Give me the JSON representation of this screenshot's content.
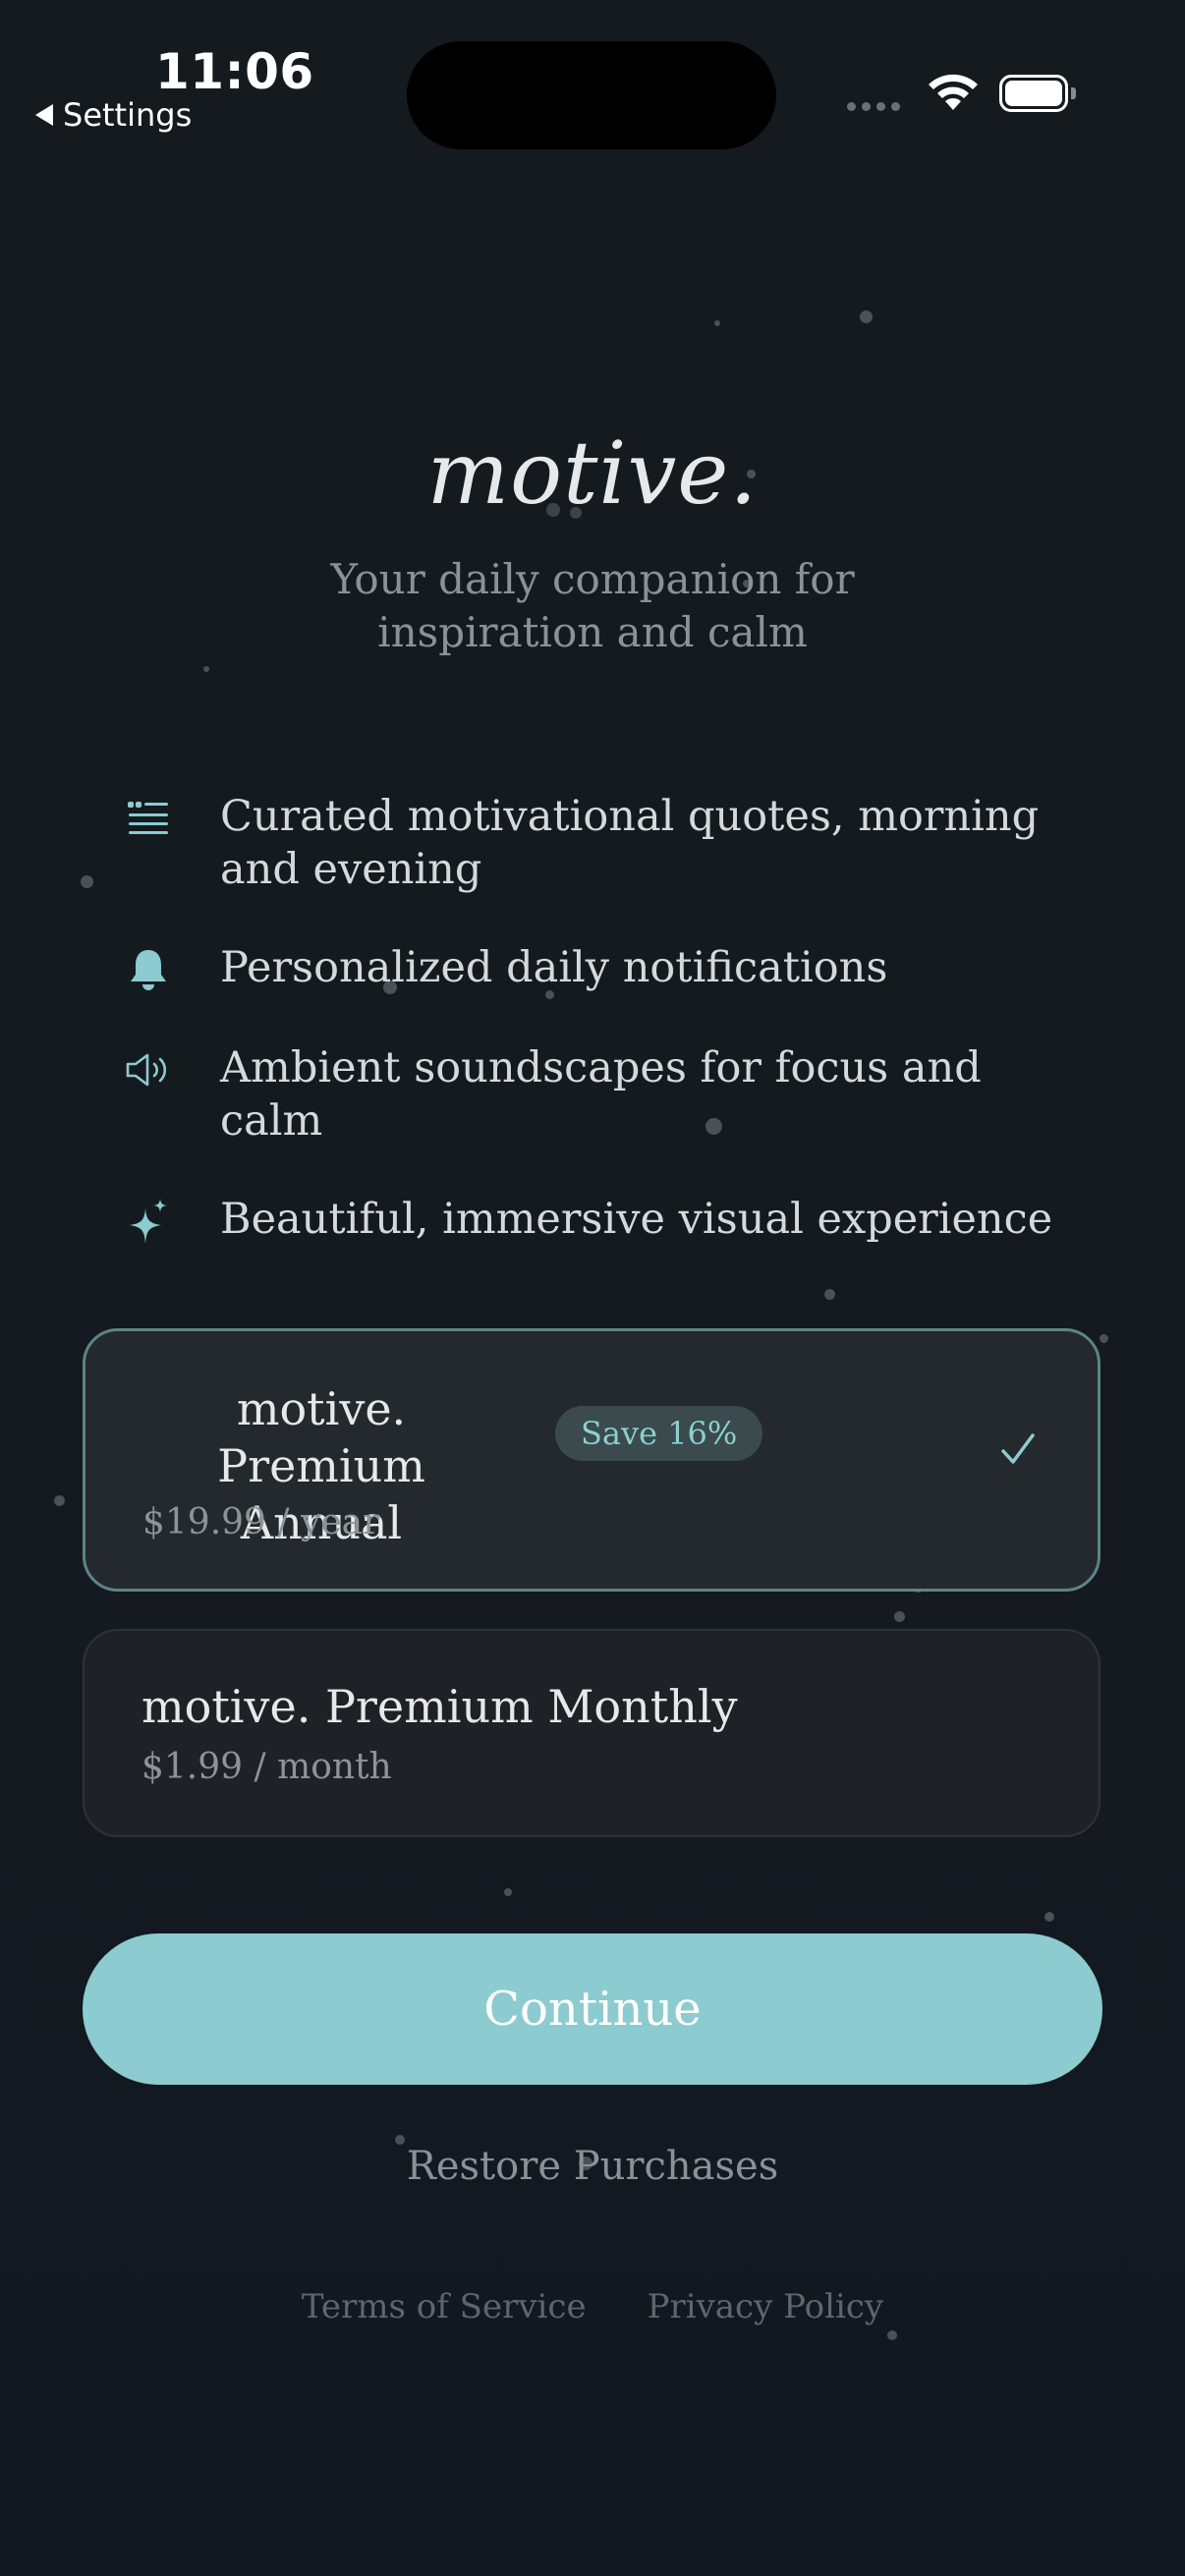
{
  "status_bar": {
    "time": "11:06",
    "back_label": "Settings"
  },
  "header": {
    "brand": "motive.",
    "tagline_line1": "Your daily companion for",
    "tagline_line2": "inspiration and calm"
  },
  "features": [
    {
      "icon": "quote-list-icon",
      "text_line1": "Curated motivational quotes, morning",
      "text_line2": "and evening"
    },
    {
      "icon": "bell-icon",
      "text": "Personalized daily notifications"
    },
    {
      "icon": "speaker-icon",
      "text": "Ambient soundscapes for focus and calm"
    },
    {
      "icon": "sparkles-icon",
      "text": "Beautiful, immersive visual experience"
    }
  ],
  "plans": {
    "annual": {
      "title_line1": "motive. Premium",
      "title_line2": "Annual",
      "badge": "Save 16%",
      "price": "$19.99 / year",
      "selected": true
    },
    "monthly": {
      "title": "motive. Premium Monthly",
      "price": "$1.99 / month",
      "selected": false
    }
  },
  "actions": {
    "continue_label": "Continue",
    "restore_label": "Restore Purchases",
    "terms_label": "Terms of Service",
    "privacy_label": "Privacy Policy"
  },
  "colors": {
    "accent": "#8ccbcf",
    "background": "#141b1f",
    "card_selected_border": "#5d8584"
  }
}
